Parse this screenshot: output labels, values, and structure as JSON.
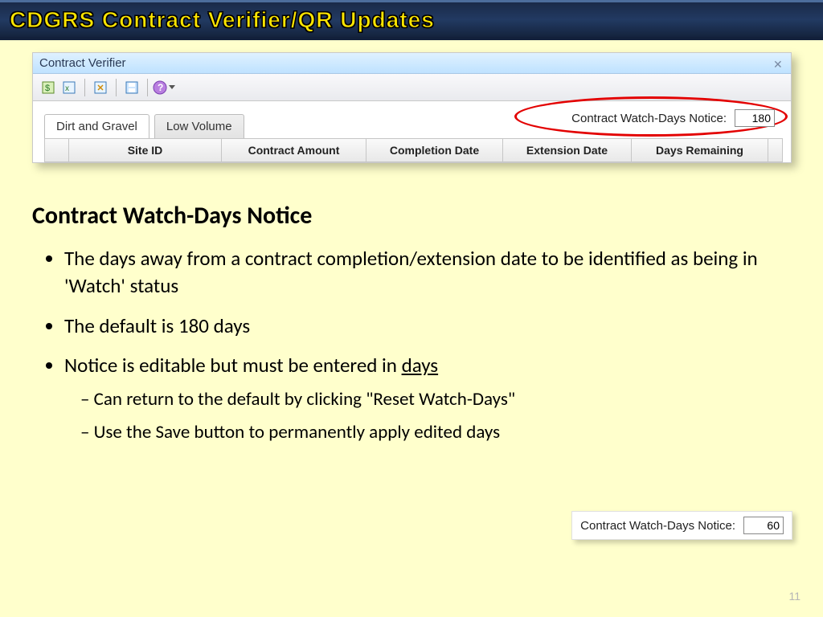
{
  "banner": {
    "title": "CDGRS Contract Verifier/QR Updates"
  },
  "window": {
    "title": "Contract Verifier",
    "tabs": [
      {
        "label": "Dirt and Gravel",
        "active": true
      },
      {
        "label": "Low Volume",
        "active": false
      }
    ],
    "watchdays": {
      "label": "Contract Watch-Days Notice:",
      "value": "180"
    },
    "columns": [
      "",
      "Site ID",
      "Contract Amount",
      "Completion Date",
      "Extension Date",
      "Days Remaining"
    ]
  },
  "content": {
    "heading": "Contract Watch-Days Notice",
    "bullets": [
      "The days away from a contract completion/extension date to be identified as being in 'Watch' status",
      "The default is 180 days",
      "Notice is editable but must be entered in "
    ],
    "bullet3_underlined": "days",
    "subbullets": [
      "Can return to the default by clicking \"Reset Watch-Days\"",
      "Use the Save button to permanently apply edited days"
    ]
  },
  "example": {
    "label": "Contract Watch-Days Notice:",
    "value": "60"
  },
  "page_number": "11"
}
